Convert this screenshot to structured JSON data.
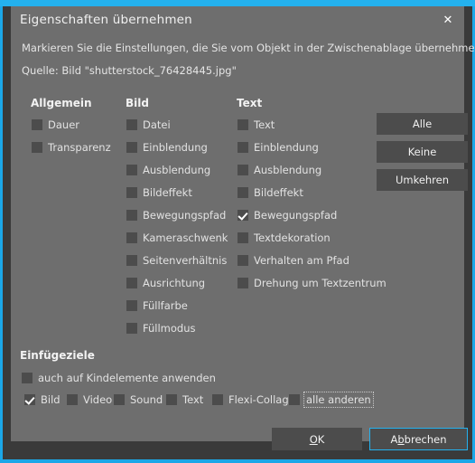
{
  "window": {
    "title": "Eigenschaften übernehmen",
    "close_icon": "close-icon",
    "close_glyph": "✕",
    "accent_color": "#24b1ee",
    "dialog_bg": "#6e6e6e",
    "control_bg": "#4c4c4c"
  },
  "description": {
    "line1": "Markieren Sie die Einstellungen, die Sie vom Objekt in der Zwischenablage übernehmen wollen.",
    "line2": "Quelle: Bild \"shutterstock_76428445.jpg\""
  },
  "columns": [
    {
      "heading": "Allgemein",
      "items": [
        {
          "label": "Dauer",
          "checked": false
        },
        {
          "label": "Transparenz",
          "checked": false
        }
      ]
    },
    {
      "heading": "Bild",
      "items": [
        {
          "label": "Datei",
          "checked": false
        },
        {
          "label": "Einblendung",
          "checked": false
        },
        {
          "label": "Ausblendung",
          "checked": false
        },
        {
          "label": "Bildeffekt",
          "checked": false
        },
        {
          "label": "Bewegungspfad",
          "checked": false
        },
        {
          "label": "Kameraschwenk",
          "checked": false
        },
        {
          "label": "Seitenverhältnis",
          "checked": false
        },
        {
          "label": "Ausrichtung",
          "checked": false
        },
        {
          "label": "Füllfarbe",
          "checked": false
        },
        {
          "label": "Füllmodus",
          "checked": false
        }
      ]
    },
    {
      "heading": "Text",
      "items": [
        {
          "label": "Text",
          "checked": false
        },
        {
          "label": "Einblendung",
          "checked": false
        },
        {
          "label": "Ausblendung",
          "checked": false
        },
        {
          "label": "Bildeffekt",
          "checked": false
        },
        {
          "label": "Bewegungspfad",
          "checked": true
        },
        {
          "label": "Textdekoration",
          "checked": false
        },
        {
          "label": "Verhalten am Pfad",
          "checked": false
        },
        {
          "label": "Drehung um Textzentrum",
          "checked": false
        }
      ]
    }
  ],
  "selection_buttons": [
    {
      "label": "Alle"
    },
    {
      "label": "Keine"
    },
    {
      "label": "Umkehren"
    }
  ],
  "paste_targets": {
    "heading": "Einfügeziele",
    "apply_to_children": {
      "label": "auch auf Kindelemente anwenden",
      "checked": false
    },
    "types": [
      {
        "label": "Bild",
        "checked": true,
        "focused": false
      },
      {
        "label": "Video",
        "checked": false,
        "focused": false
      },
      {
        "label": "Sound",
        "checked": false,
        "focused": false
      },
      {
        "label": "Text",
        "checked": false,
        "focused": false
      },
      {
        "label": "Flexi-Collage",
        "checked": false,
        "focused": false
      },
      {
        "label": "alle anderen",
        "checked": false,
        "focused": true
      }
    ]
  },
  "footer": {
    "ok": {
      "prefix": "",
      "mnemonic": "O",
      "suffix": "K"
    },
    "cancel": {
      "prefix": "A",
      "mnemonic": "b",
      "suffix": "brechen"
    }
  }
}
